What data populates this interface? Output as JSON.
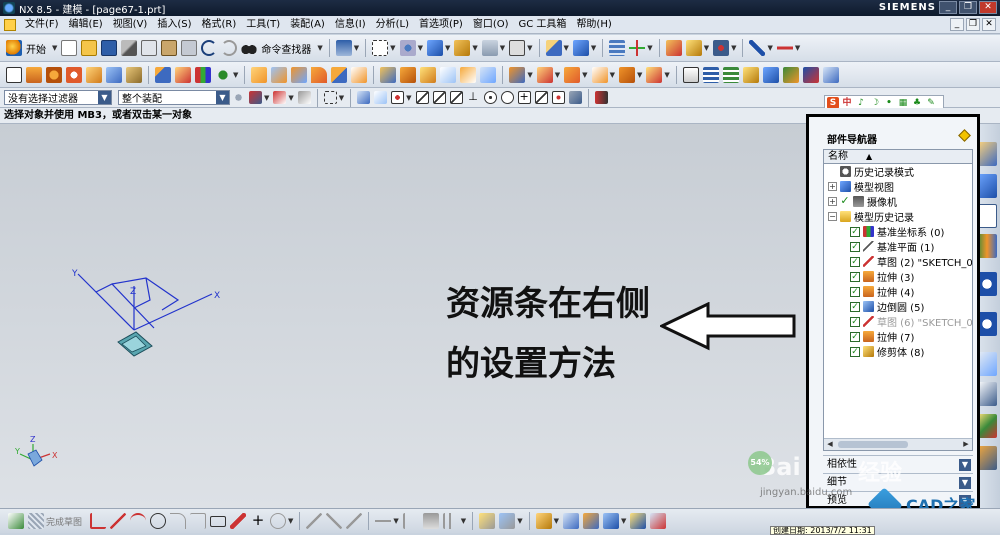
{
  "window": {
    "title": "NX 8.5 - 建模 - [page67-1.prt]",
    "brand": "SIEMENS",
    "minimize": "_",
    "restore": "❐",
    "close": "✕"
  },
  "menubar": {
    "items": [
      "文件(F)",
      "编辑(E)",
      "视图(V)",
      "插入(S)",
      "格式(R)",
      "工具(T)",
      "装配(A)",
      "信息(I)",
      "分析(L)",
      "首选项(P)",
      "窗口(O)",
      "GC 工具箱",
      "帮助(H)"
    ]
  },
  "toolbar": {
    "start_label": "开始",
    "command_finder_label": "命令查找器",
    "filter_select": "没有选择过滤器",
    "scope_select": "整个装配"
  },
  "cue_line": "选择对象并使用 MB3，或者双击某一对象",
  "canvas": {
    "axis_x": "X",
    "axis_y": "Y",
    "axis_z": "Z",
    "triad_x": "X",
    "triad_y": "Y",
    "triad_z": "Z",
    "annotation_line1": "资源条在右侧",
    "annotation_line2": "的设置方法"
  },
  "part_navigator": {
    "title": "部件导航器",
    "column_header": "名称",
    "nodes": [
      {
        "label": "历史记录模式",
        "icon": "clock-icon",
        "checked": false,
        "expander": "",
        "indent": 0
      },
      {
        "label": "模型视图",
        "icon": "model-view-icon",
        "checked": false,
        "expander": "+",
        "indent": 0
      },
      {
        "label": "摄像机",
        "icon": "camera-icon",
        "checked": true,
        "expander": "+",
        "indent": 0
      },
      {
        "label": "模型历史记录",
        "icon": "folder-icon",
        "checked": false,
        "expander": "−",
        "indent": 0
      },
      {
        "label": "基准坐标系 (0)",
        "icon": "datum-csys-icon",
        "checked": true,
        "expander": "",
        "indent": 1
      },
      {
        "label": "基准平面 (1)",
        "icon": "datum-plane-icon",
        "checked": true,
        "expander": "",
        "indent": 1
      },
      {
        "label": "草图 (2) \"SKETCH_0...",
        "icon": "sketch-icon",
        "checked": true,
        "expander": "",
        "indent": 1
      },
      {
        "label": "拉伸 (3)",
        "icon": "extrude-icon",
        "checked": true,
        "expander": "",
        "indent": 1
      },
      {
        "label": "拉伸 (4)",
        "icon": "extrude-icon",
        "checked": true,
        "expander": "",
        "indent": 1
      },
      {
        "label": "边倒圆 (5)",
        "icon": "edge-blend-icon",
        "checked": true,
        "expander": "",
        "indent": 1
      },
      {
        "label": "草图 (6) \"SKETCH_0...",
        "icon": "sketch-icon",
        "checked": true,
        "expander": "",
        "indent": 1,
        "disabled": true
      },
      {
        "label": "拉伸 (7)",
        "icon": "extrude-icon",
        "checked": true,
        "expander": "",
        "indent": 1
      },
      {
        "label": "修剪体 (8)",
        "icon": "trim-body-icon",
        "checked": true,
        "expander": "",
        "indent": 1
      }
    ],
    "panels": [
      "相依性",
      "细节",
      "预览"
    ]
  },
  "bottom_toolbar": {
    "finish_sketch_label": "完成草图"
  },
  "watermark": {
    "baidu": "Bai",
    "jingyan": "经验",
    "url": "jingyan.baidu.com",
    "cad_site": "CAD之家",
    "badge": "54%"
  },
  "tooltip": "创建日期: 2013/7/2 11:31",
  "colors": {
    "accent": "#3b5b8a",
    "check": "#1b8a1b",
    "axis": "#2233cc",
    "title_bg": "#0e1a2c"
  }
}
